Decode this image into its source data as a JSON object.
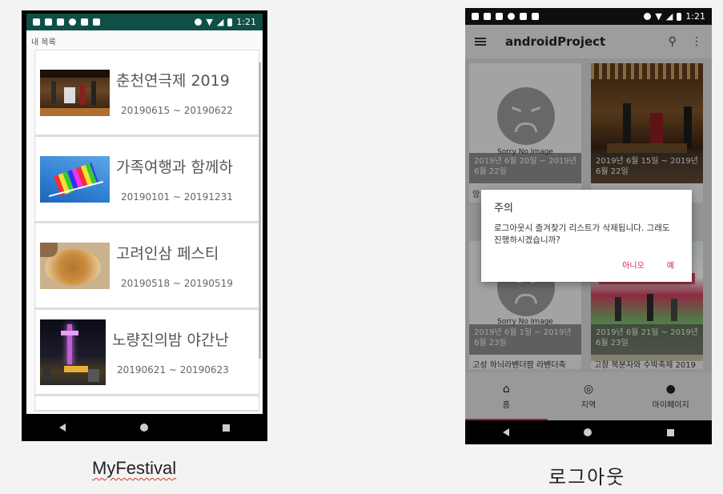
{
  "status_time": "1:21",
  "myfestival": {
    "header": "내 목록",
    "items": [
      {
        "title": "춘천연극제 2019",
        "dates": "20190615 ~ 20190622"
      },
      {
        "title": "가족여행과 함께하",
        "dates": "20190101 ~ 20191231"
      },
      {
        "title": "고려인삼 페스티",
        "dates": "20190518 ~ 20190519"
      },
      {
        "title": "노량진의밤 야간난",
        "dates": "20190621 ~ 20190623"
      }
    ]
  },
  "logout": {
    "app_title": "androidProject",
    "grid": [
      {
        "no_image": "Sorry No Image",
        "dates": "2019년 6월 20일 ~ 2019년 6월 22일",
        "name": "앙"
      },
      {
        "no_image": "",
        "dates": "2019년 6월 15일 ~ 2019년 6월 22일",
        "name": ""
      },
      {
        "no_image": "Sorry No Image",
        "dates": "2019년 6월 1일 ~ 2019년 6월 23일",
        "name": "고성 하늬라벤더팜 라벤더축"
      },
      {
        "no_image": "",
        "dates": "2019년 6월 21일 ~ 2019년 6월 23일",
        "name": "고창 복분자와 수박축제 2019"
      }
    ],
    "bottom_nav": [
      {
        "label": "홈",
        "icon": "home-icon"
      },
      {
        "label": "지역",
        "icon": "location-icon"
      },
      {
        "label": "마이페이지",
        "icon": "person-icon"
      }
    ],
    "dialog": {
      "title": "주의",
      "message": "로그아웃시 즐겨찾기 리스트가 삭제됩니다. 그래도 진행하시겠습니까?",
      "no": "아니오",
      "yes": "예"
    }
  },
  "captions": {
    "left": "MyFestival",
    "right": "로그아웃"
  },
  "colors": {
    "status_bar": "#0f4f45",
    "accent": "#d81b60"
  }
}
